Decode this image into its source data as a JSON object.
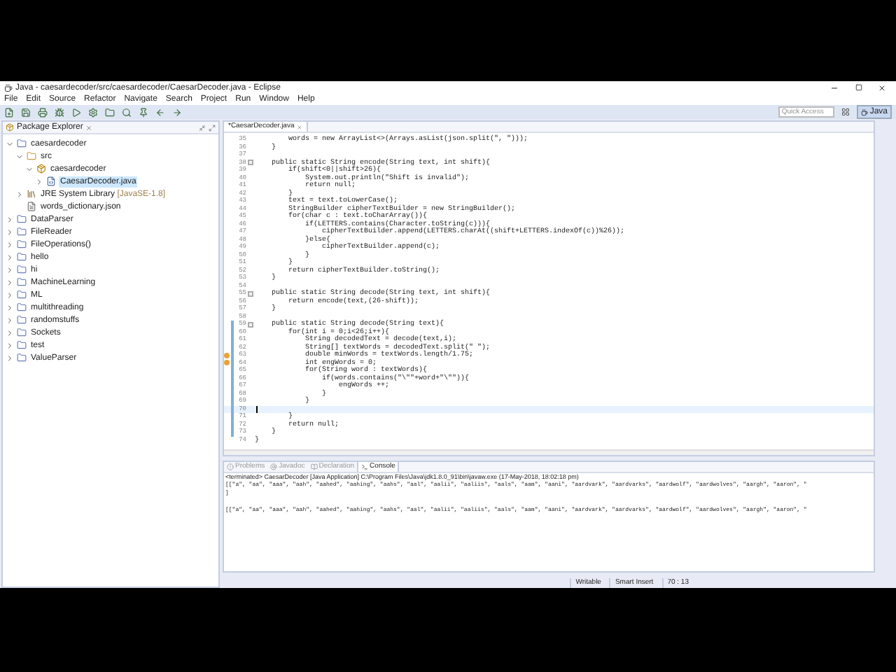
{
  "window": {
    "title": "Java - caesardecoder/src/caesardecoder/CaesarDecoder.java - Eclipse"
  },
  "menu": [
    "File",
    "Edit",
    "Source",
    "Refactor",
    "Navigate",
    "Search",
    "Project",
    "Run",
    "Window",
    "Help"
  ],
  "quick_access": {
    "placeholder": "Quick Access"
  },
  "perspective": {
    "label": "Java",
    "selected": true
  },
  "package_explorer": {
    "title": "Package Explorer",
    "tree": [
      {
        "label": "caesardecoder",
        "kind": "project",
        "expanded": true,
        "selected": false,
        "children": [
          {
            "label": "src",
            "kind": "folder",
            "expanded": true,
            "selected": false,
            "children": [
              {
                "label": "caesardecoder",
                "kind": "package",
                "expanded": true,
                "selected": false,
                "children": [
                  {
                    "label": "CaesarDecoder.java",
                    "kind": "java",
                    "expanded": false,
                    "selected": true
                  }
                ]
              }
            ]
          },
          {
            "label": "JRE System Library",
            "suffix": "[JavaSE-1.8]",
            "kind": "library",
            "expanded": false,
            "selected": false
          },
          {
            "label": "words_dictionary.json",
            "kind": "file",
            "selected": false
          }
        ]
      },
      {
        "label": "DataParser",
        "kind": "project",
        "expanded": false,
        "selected": false
      },
      {
        "label": "FileReader",
        "kind": "project",
        "expanded": false,
        "selected": false
      },
      {
        "label": "FileOperations()",
        "kind": "project",
        "expanded": false,
        "selected": false
      },
      {
        "label": "hello",
        "kind": "project",
        "expanded": false,
        "selected": false
      },
      {
        "label": "hi",
        "kind": "project",
        "expanded": false,
        "selected": false
      },
      {
        "label": "MachineLearning",
        "kind": "project",
        "expanded": false,
        "selected": false
      },
      {
        "label": "ML",
        "kind": "project",
        "expanded": false,
        "selected": false
      },
      {
        "label": "multithreading",
        "kind": "project",
        "expanded": false,
        "selected": false
      },
      {
        "label": "randomstuffs",
        "kind": "project",
        "expanded": false,
        "selected": false
      },
      {
        "label": "Sockets",
        "kind": "project",
        "expanded": false,
        "selected": false
      },
      {
        "label": "test",
        "kind": "project",
        "expanded": false,
        "selected": false
      },
      {
        "label": "ValueParser",
        "kind": "project",
        "expanded": false,
        "selected": false
      }
    ]
  },
  "editor": {
    "tab": {
      "label": "*CaesarDecoder.java",
      "selected": true
    },
    "lines": [
      {
        "number": "35",
        "code": "        words = new ArrayList<>(Arrays.asList(json.split(\", \")));",
        "fold": false,
        "changed": false,
        "warning": false,
        "current": false
      },
      {
        "number": "36",
        "code": "    }",
        "fold": false,
        "changed": false,
        "warning": false,
        "current": false
      },
      {
        "number": "37",
        "fold": false,
        "changed": false,
        "warning": false,
        "current": false
      },
      {
        "number": "38",
        "code": "    public static String encode(String text, int shift){",
        "fold": true,
        "changed": false,
        "warning": false,
        "current": false
      },
      {
        "number": "39",
        "code": "        if(shift<0||shift>26){",
        "fold": false,
        "changed": false,
        "warning": false,
        "current": false
      },
      {
        "number": "40",
        "code": "            System.out.println(\"Shift is invalid\");",
        "fold": false,
        "changed": false,
        "warning": false,
        "current": false
      },
      {
        "number": "41",
        "code": "            return null;",
        "fold": false,
        "changed": false,
        "warning": false,
        "current": false
      },
      {
        "number": "42",
        "code": "        }",
        "fold": false,
        "changed": false,
        "warning": false,
        "current": false
      },
      {
        "number": "43",
        "code": "        text = text.toLowerCase();",
        "fold": false,
        "changed": false,
        "warning": false,
        "current": false
      },
      {
        "number": "44",
        "code": "        StringBuilder cipherTextBuilder = new StringBuilder();",
        "fold": false,
        "changed": false,
        "warning": false,
        "current": false
      },
      {
        "number": "45",
        "code": "        for(char c : text.toCharArray()){",
        "fold": false,
        "changed": false,
        "warning": false,
        "current": false
      },
      {
        "number": "46",
        "code": "            if(LETTERS.contains(Character.toString(c))){",
        "fold": false,
        "changed": false,
        "warning": false,
        "current": false
      },
      {
        "number": "47",
        "code": "                cipherTextBuilder.append(LETTERS.charAt((shift+LETTERS.indexOf(c))%26));",
        "fold": false,
        "changed": false,
        "warning": false,
        "current": false
      },
      {
        "number": "48",
        "code": "            }else{",
        "fold": false,
        "changed": false,
        "warning": false,
        "current": false
      },
      {
        "number": "49",
        "code": "                cipherTextBuilder.append(c);",
        "fold": false,
        "changed": false,
        "warning": false,
        "current": false
      },
      {
        "number": "50",
        "code": "            }",
        "fold": false,
        "changed": false,
        "warning": false,
        "current": false
      },
      {
        "number": "51",
        "code": "        }",
        "fold": false,
        "changed": false,
        "warning": false,
        "current": false
      },
      {
        "number": "52",
        "code": "        return cipherTextBuilder.toString();",
        "fold": false,
        "changed": false,
        "warning": false,
        "current": false
      },
      {
        "number": "53",
        "code": "    }",
        "fold": false,
        "changed": false,
        "warning": false,
        "current": false
      },
      {
        "number": "54",
        "fold": false,
        "changed": false,
        "warning": false,
        "current": false
      },
      {
        "number": "55",
        "code": "    public static String decode(String text, int shift){",
        "fold": true,
        "changed": false,
        "warning": false,
        "current": false
      },
      {
        "number": "56",
        "code": "        return encode(text,(26-shift));",
        "fold": false,
        "changed": false,
        "warning": false,
        "current": false
      },
      {
        "number": "57",
        "code": "    }",
        "fold": false,
        "changed": false,
        "warning": false,
        "current": false
      },
      {
        "number": "58",
        "fold": false,
        "changed": false,
        "warning": false,
        "current": false
      },
      {
        "number": "59",
        "code": "    public static String decode(String text){",
        "fold": true,
        "changed": true,
        "warning": false,
        "current": false
      },
      {
        "number": "60",
        "code": "        for(int i = 0;i<26;i++){",
        "fold": false,
        "changed": true,
        "warning": false,
        "current": false
      },
      {
        "number": "61",
        "code": "            String decodedText = decode(text,i);",
        "fold": false,
        "changed": true,
        "warning": false,
        "current": false
      },
      {
        "number": "62",
        "code": "            String[] textWords = decodedText.split(\" \");",
        "fold": false,
        "changed": true,
        "warning": false,
        "current": false
      },
      {
        "number": "63",
        "code": "            double minWords = textWords.length/1.75;",
        "fold": false,
        "changed": true,
        "warning": true,
        "current": false
      },
      {
        "number": "64",
        "code": "            int engWords = 0;",
        "fold": false,
        "changed": true,
        "warning": true,
        "current": false
      },
      {
        "number": "65",
        "code": "            for(String word : textWords){",
        "fold": false,
        "changed": true,
        "warning": false,
        "current": false
      },
      {
        "number": "66",
        "code": "                if(words.contains(\"\\\"\"+word+\"\\\"\")){",
        "fold": false,
        "changed": true,
        "warning": false,
        "current": false
      },
      {
        "number": "67",
        "code": "                    engWords ++;",
        "fold": false,
        "changed": true,
        "warning": false,
        "current": false
      },
      {
        "number": "68",
        "code": "                }",
        "fold": false,
        "changed": true,
        "warning": false,
        "current": false
      },
      {
        "number": "69",
        "code": "            }",
        "fold": false,
        "changed": true,
        "warning": false,
        "current": false
      },
      {
        "number": "70",
        "fold": false,
        "changed": true,
        "warning": false,
        "current": true
      },
      {
        "number": "71",
        "code": "        }",
        "fold": false,
        "changed": true,
        "warning": false,
        "current": false
      },
      {
        "number": "72",
        "code": "        return null;",
        "fold": false,
        "changed": true,
        "warning": false,
        "current": false
      },
      {
        "number": "73",
        "code": "    }",
        "fold": false,
        "changed": true,
        "warning": false,
        "current": false
      },
      {
        "number": "74",
        "code": "}",
        "fold": false,
        "changed": false,
        "warning": false,
        "current": false
      }
    ]
  },
  "console": {
    "tabs": [
      {
        "label": "Problems",
        "kind": "problems",
        "selected": false
      },
      {
        "label": "Javadoc",
        "kind": "javadoc",
        "selected": false
      },
      {
        "label": "Declaration",
        "kind": "declaration",
        "selected": false
      },
      {
        "label": "Console",
        "kind": "console",
        "selected": true
      }
    ],
    "header": "<terminated> CaesarDecoder [Java Application] C:\\Program Files\\Java\\jdk1.8.0_91\\bin\\javaw.exe (17-May-2018, 18:02:18 pm)",
    "output": [
      {
        "kind": "text",
        "text": "[[\"a\", \"aa\", \"aaa\", \"aah\", \"aahed\", \"aahing\", \"aahs\", \"aal\", \"aalii\", \"aaliis\", \"aals\", \"aam\", \"aani\", \"aardvark\", \"aardvarks\", \"aardwolf\", \"aardwolves\", \"aargh\", \"aaron\", \""
      },
      {
        "kind": "text",
        "text": "]"
      },
      {
        "kind": "blank"
      },
      {
        "kind": "text",
        "text": "[[\"a\", \"aa\", \"aaa\", \"aah\", \"aahed\", \"aahing\", \"aahs\", \"aal\", \"aalii\", \"aaliis\", \"aals\", \"aam\", \"aani\", \"aardvark\", \"aardvarks\", \"aardwolf\", \"aardwolves\", \"aargh\", \"aaron\", \""
      }
    ]
  },
  "status_bar": [
    "Writable",
    "Smart Insert",
    "70 : 13"
  ]
}
